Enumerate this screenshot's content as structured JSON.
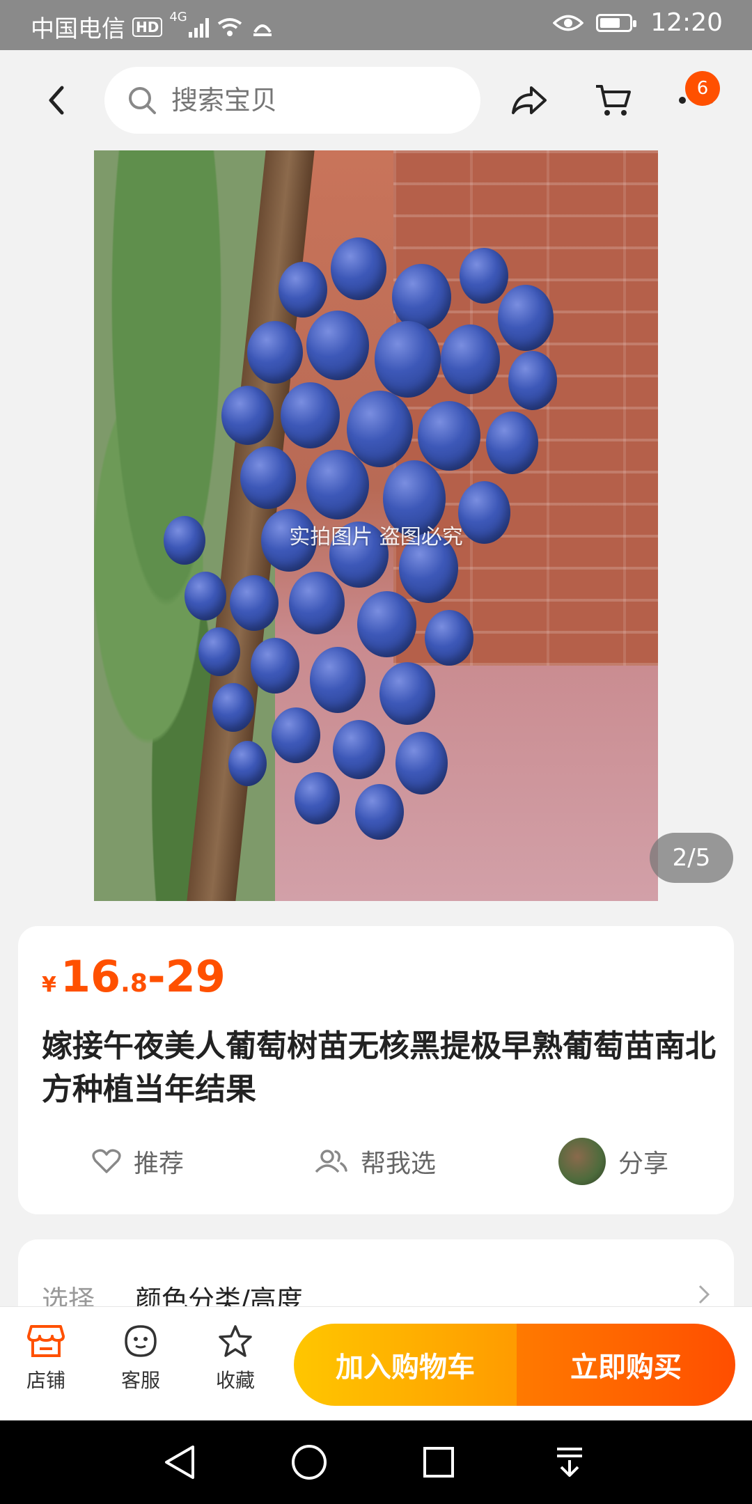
{
  "status_bar": {
    "carrier": "中国电信",
    "hd": "HD",
    "network": "4G",
    "time": "12:20"
  },
  "header": {
    "search_placeholder": "搜索宝贝",
    "cart_badge": "6"
  },
  "gallery": {
    "watermark": "实拍图片 盗图必究",
    "counter": "2/5"
  },
  "product": {
    "currency": "¥",
    "price_int": "16",
    "price_dec": ".8",
    "price_max": "-29",
    "title": "嫁接午夜美人葡萄树苗无核黑提极早熟葡萄苗南北方种植当年结果"
  },
  "actions": {
    "recommend": "推荐",
    "help_choose": "帮我选",
    "share": "分享"
  },
  "select": {
    "label": "选择",
    "value": "颜色分类/高度"
  },
  "bottom_bar": {
    "shop": "店铺",
    "service": "客服",
    "favorite": "收藏",
    "add_cart": "加入购物车",
    "buy_now": "立即购买"
  },
  "colors": {
    "accent": "#ff5000",
    "cart_btn": "#ffb000",
    "buy_btn": "#ff5a00"
  }
}
